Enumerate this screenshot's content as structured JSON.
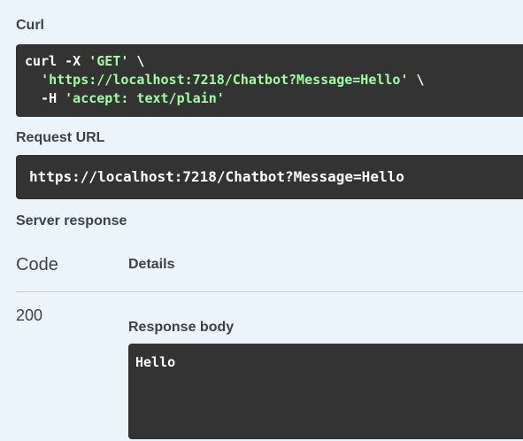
{
  "curl": {
    "label": "Curl",
    "line1_cmd": "curl -X ",
    "line1_method": "'GET'",
    "line1_tail": " \\",
    "line2_indent": "  ",
    "line2_url": "'https://localhost:7218/Chatbot?Message=Hello'",
    "line2_tail": " \\",
    "line3_indent": "  -H ",
    "line3_header": "'accept: text/plain'"
  },
  "request_url": {
    "label": "Request URL",
    "value": "https://localhost:7218/Chatbot?Message=Hello"
  },
  "server_response": {
    "label": "Server response",
    "col_code": "Code",
    "col_details": "Details",
    "status_code": "200",
    "body_label": "Response body",
    "body_value": "Hello"
  },
  "colors": {
    "background": "#ebf3fb",
    "code_bg": "#333333",
    "string_green": "#a2fca2",
    "text": "#3b4151"
  }
}
